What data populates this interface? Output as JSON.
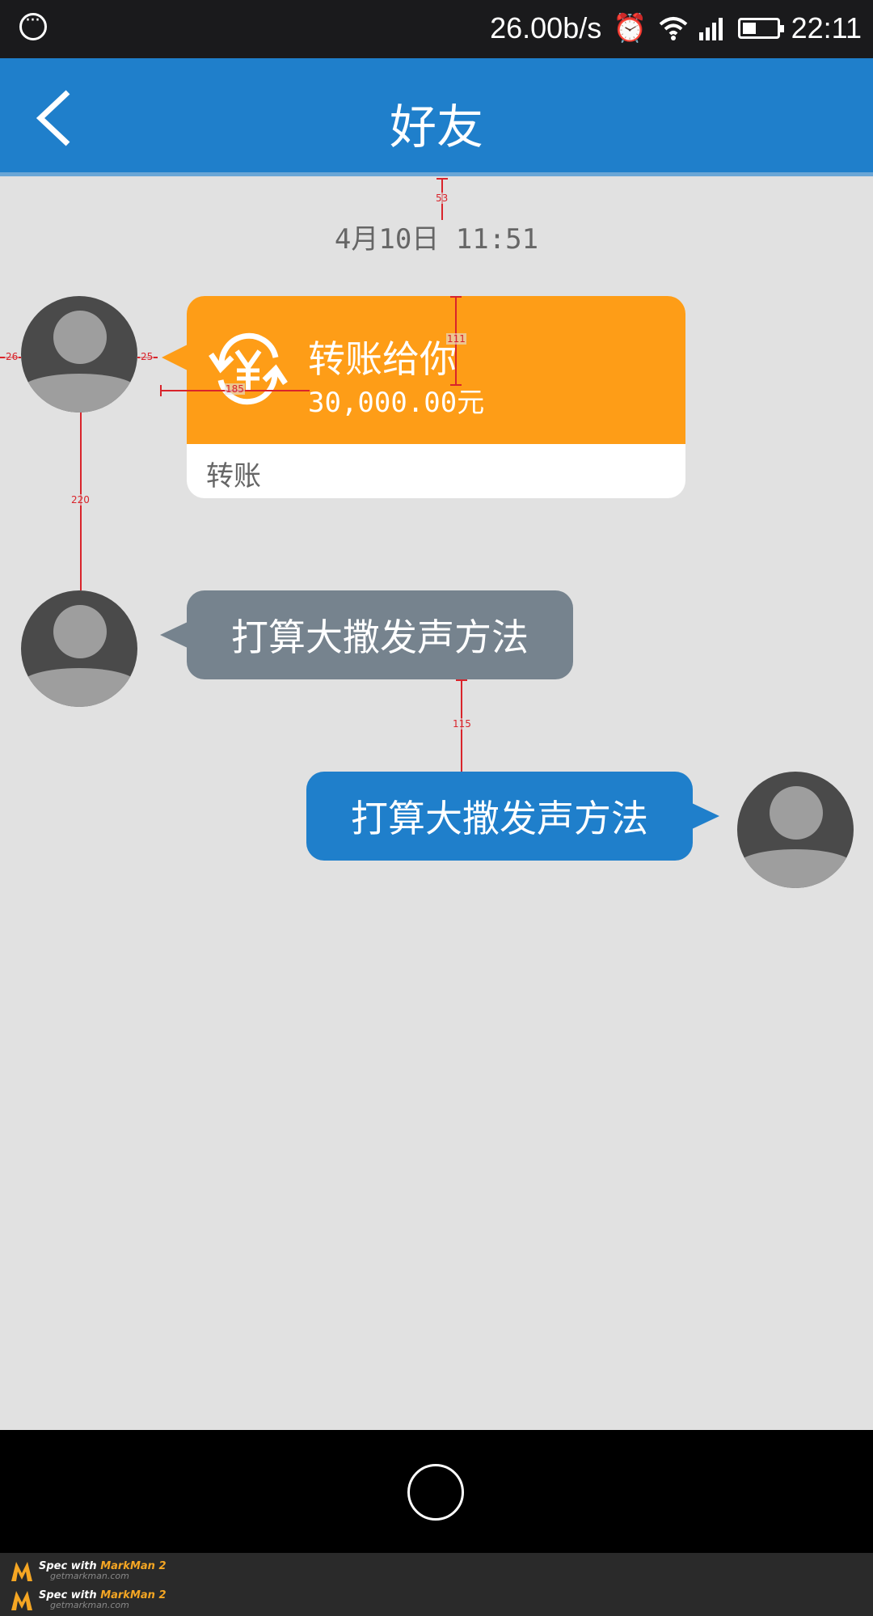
{
  "status_bar": {
    "net_speed": "26.00b/s",
    "time": "22:11",
    "icons": [
      "chat-bubble-icon",
      "alarm-icon",
      "wifi-icon",
      "signal-icon",
      "battery-icon"
    ],
    "battery_level": 0.4
  },
  "app_bar": {
    "title": "好友",
    "back_icon": "chevron-left-icon",
    "color": "#1f7fcb"
  },
  "chat": {
    "timestamp": "4月10日 11:51",
    "transfer": {
      "title": "转账给你",
      "amount": "30,000.00元",
      "footer": "转账",
      "icon": "yen-refresh-icon",
      "color": "#fe9d17"
    },
    "messages": [
      {
        "side": "left",
        "text": "打算大撒发声方法",
        "color": "#76838e"
      },
      {
        "side": "right",
        "text": "打算大撒发声方法",
        "color": "#1f7fcb"
      }
    ]
  },
  "measurements": [
    "53",
    "111",
    "26",
    "25",
    "185",
    "220",
    "115"
  ],
  "nav_bar": {
    "home_icon": "home-circle-icon"
  },
  "watermark": {
    "prefix": "Spec with",
    "brand": "MarkMan 2",
    "url": "getmarkman.com"
  }
}
